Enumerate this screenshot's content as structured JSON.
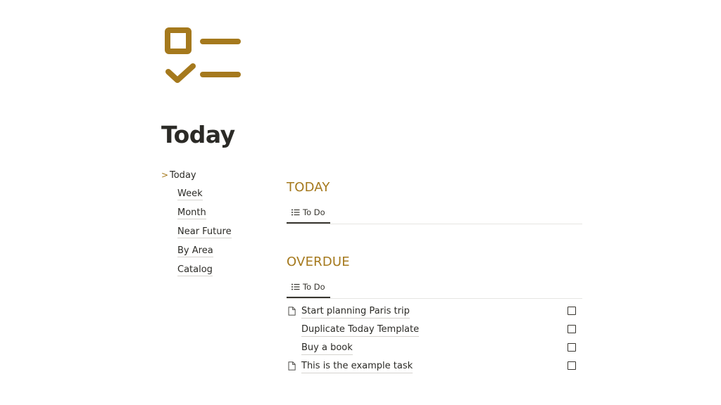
{
  "page": {
    "title": "Today",
    "icon": "checklist-icon",
    "accent_color": "#a5791d"
  },
  "nav": {
    "current": {
      "caret": ">",
      "label": "Today"
    },
    "items": [
      {
        "label": "Week"
      },
      {
        "label": "Month"
      },
      {
        "label": "Near Future"
      },
      {
        "label": "By Area"
      },
      {
        "label": "Catalog"
      }
    ]
  },
  "sections": {
    "today": {
      "heading": "TODAY",
      "view_tab": "To Do",
      "tasks": []
    },
    "overdue": {
      "heading": "OVERDUE",
      "view_tab": "To Do",
      "tasks": [
        {
          "title": "Start planning Paris trip",
          "icon": "document-icon",
          "checked": false
        },
        {
          "title": "Duplicate Today Template",
          "icon": "",
          "checked": false
        },
        {
          "title": "Buy a book",
          "icon": "",
          "checked": false
        },
        {
          "title": "This is the example task",
          "icon": "document-icon",
          "checked": false
        }
      ]
    }
  }
}
